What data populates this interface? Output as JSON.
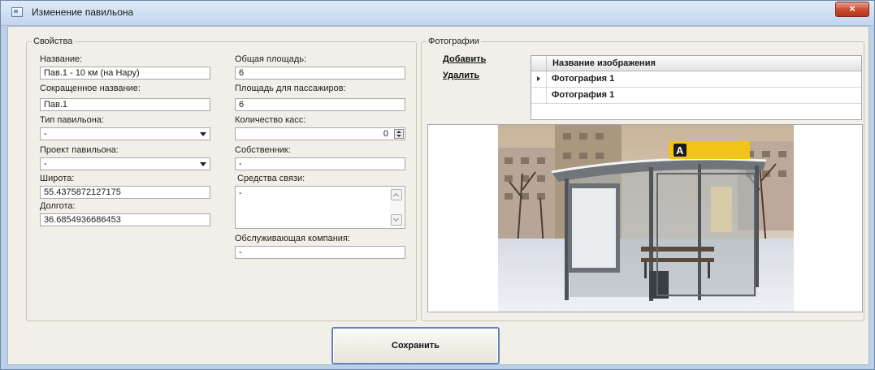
{
  "window": {
    "title": "Изменение павильона",
    "close_label": "×"
  },
  "properties": {
    "legend": "Свойства",
    "name": {
      "label": "Название:",
      "value": "Пав.1 - 10 км (на Нару)"
    },
    "short_name": {
      "label": "Сокращенное название:",
      "value": "Пав.1"
    },
    "pavilion_type": {
      "label": "Тип павильона:",
      "value": "-"
    },
    "pavilion_project": {
      "label": "Проект павильона:",
      "value": "-"
    },
    "latitude": {
      "label": "Широта:",
      "value": "55.4375872127175"
    },
    "longitude": {
      "label": "Долгота:",
      "value": "36.6854936686453"
    },
    "total_area": {
      "label": "Общая площадь:",
      "value": "6"
    },
    "passenger_area": {
      "label": "Площадь для пассажиров:",
      "value": "6"
    },
    "cash_desks": {
      "label": "Количество касс:",
      "value": "0"
    },
    "owner": {
      "label": "Собственник:",
      "value": "-"
    },
    "communications": {
      "label": "Средства связи:",
      "value": "-"
    },
    "service_company": {
      "label": "Обслуживающая компания:",
      "value": "-"
    }
  },
  "photos": {
    "legend": "Фотографии",
    "add_label": "Добавить",
    "delete_label": "Удалить",
    "grid": {
      "column_header": "Название изображения",
      "rows": [
        "Фотография 1",
        "Фотография 1"
      ]
    }
  },
  "save_label": "Сохранить"
}
